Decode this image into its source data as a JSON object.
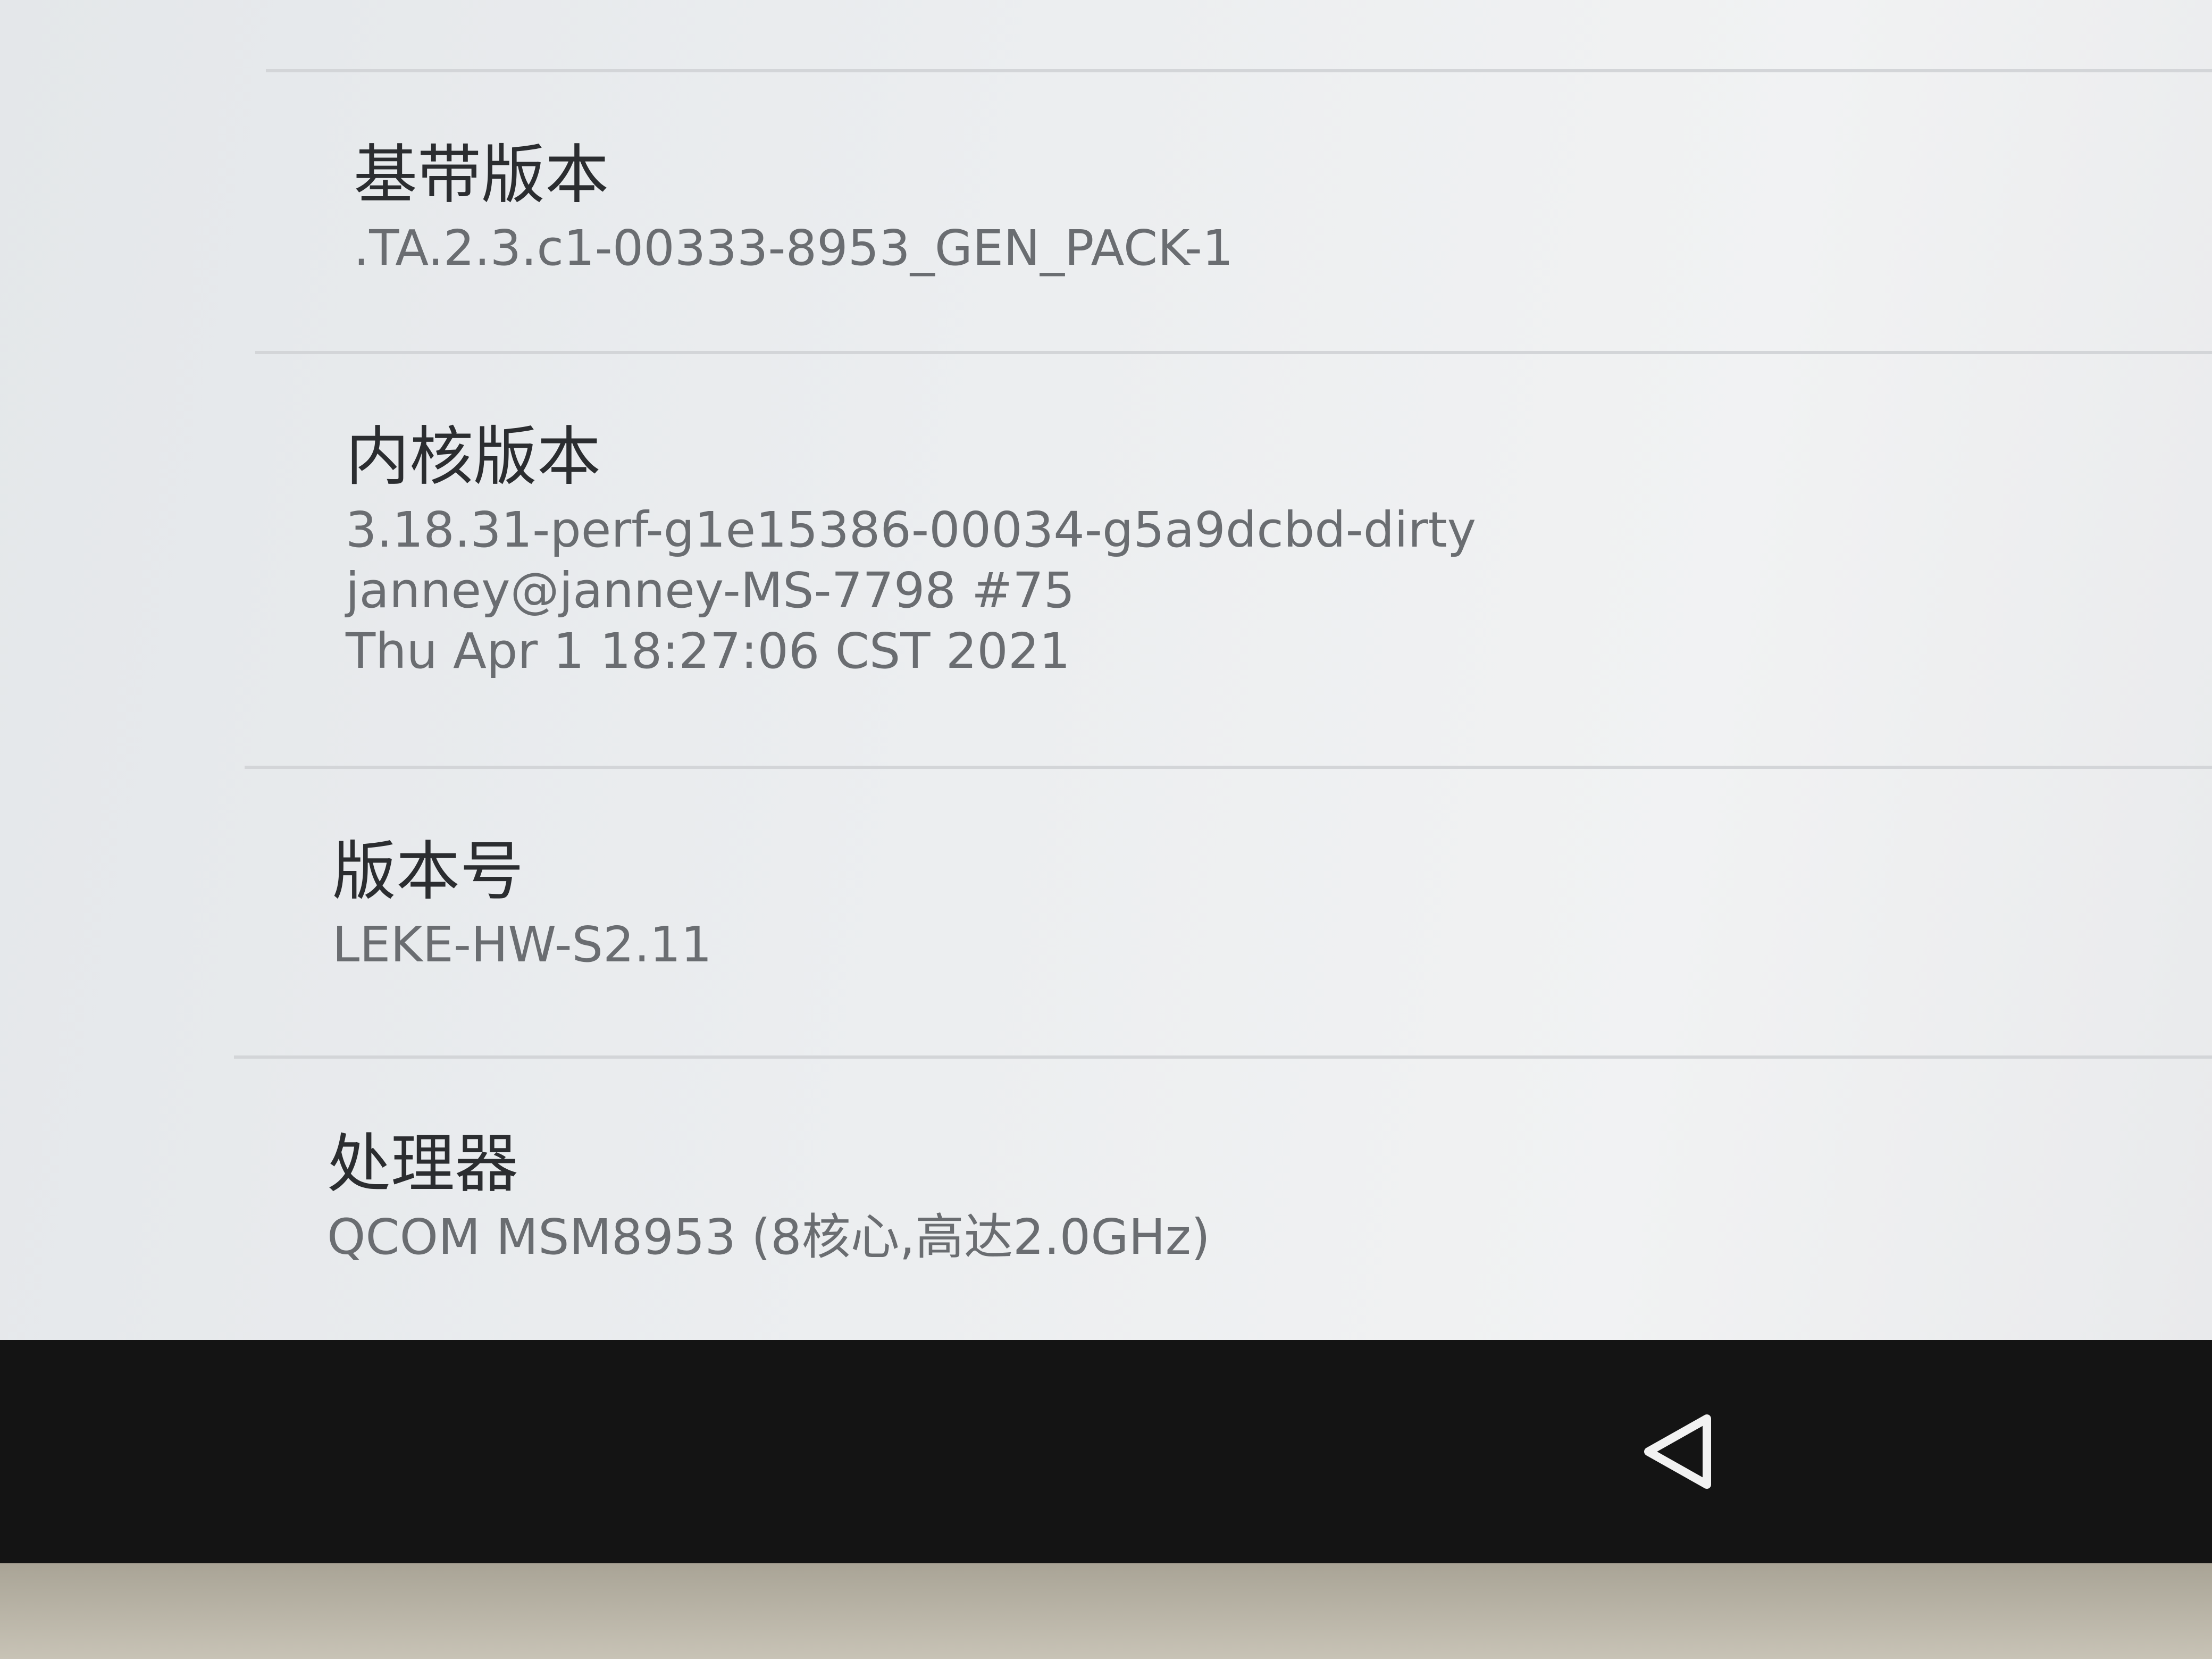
{
  "items": [
    {
      "title": "基带版本",
      "summary": ".TA.2.3.c1-00333-8953_GEN_PACK-1"
    },
    {
      "title": "内核版本",
      "summary_lines": [
        "3.18.31-perf-g1e15386-00034-g5a9dcbd-dirty",
        "janney@janney-MS-7798 #75",
        "Thu Apr 1 18:27:06 CST 2021"
      ]
    },
    {
      "title": "版本号",
      "summary": "LEKE-HW-S2.11"
    },
    {
      "title": "处理器",
      "summary": "QCOM MSM8953 (8核心,高达2.0GHz)"
    }
  ],
  "navbar": {
    "back_icon": "back-triangle-icon"
  },
  "colors": {
    "screen_bg": "#eceef0",
    "title": "#2b2d30",
    "summary": "#6a6d71",
    "navbar": "#141414"
  }
}
